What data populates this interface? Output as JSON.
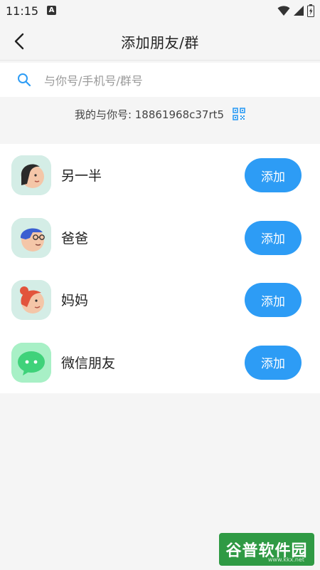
{
  "status_bar": {
    "time": "11:15",
    "notification_letter": "A"
  },
  "header": {
    "title": "添加朋友/群"
  },
  "search": {
    "placeholder": "与你号/手机号/群号"
  },
  "my_id": {
    "text": "我的与你号: 18861968c37rt5"
  },
  "contacts": [
    {
      "name": "另一半",
      "add_label": "添加",
      "avatar": "woman-face-avatar"
    },
    {
      "name": "爸爸",
      "add_label": "添加",
      "avatar": "man-glasses-avatar"
    },
    {
      "name": "妈妈",
      "add_label": "添加",
      "avatar": "red-hair-woman-avatar"
    },
    {
      "name": "微信朋友",
      "add_label": "添加",
      "avatar": "wechat-chat-bubble-avatar"
    }
  ],
  "watermark": {
    "text": "谷普软件园",
    "sub": "www.kkx.net"
  },
  "colors": {
    "accent": "#2d9cf5",
    "background": "#f5f5f5",
    "avatar_bg": "#d4ede6",
    "wechat_green": "#3fd27a"
  }
}
